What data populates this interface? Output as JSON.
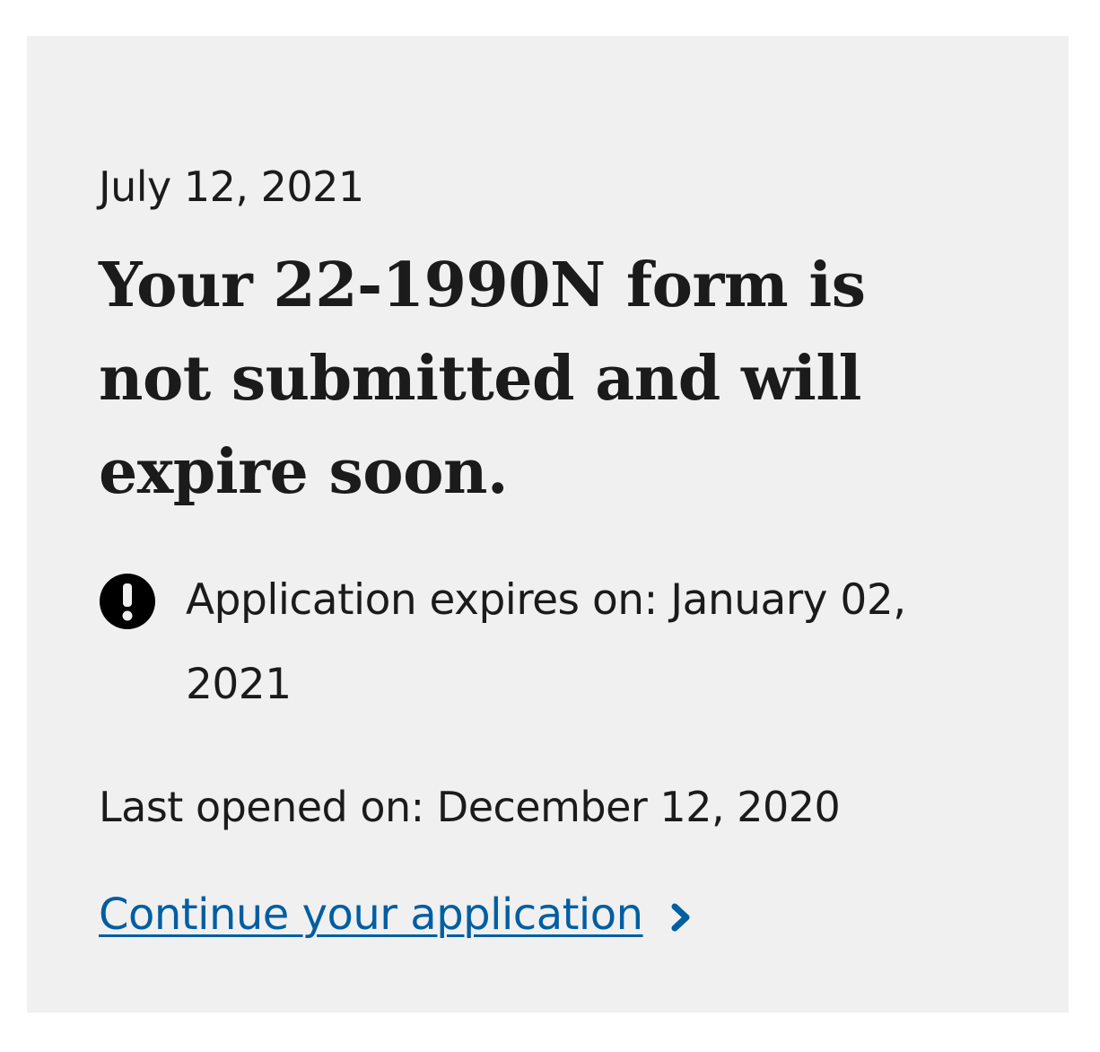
{
  "card": {
    "date": "July 12, 2021",
    "title": "Your 22-1990N form is not submitted and will expire soon.",
    "expiry_text": "Application expires on: January 02, 2021",
    "last_opened": "Last opened on: December 12, 2020",
    "continue_link": "Continue your application"
  },
  "icons": {
    "alert": "exclamation-circle-icon",
    "chevron": "chevron-right-icon"
  },
  "colors": {
    "card_background": "#f0f0f0",
    "text": "#1b1b1b",
    "link": "#005ea2"
  }
}
